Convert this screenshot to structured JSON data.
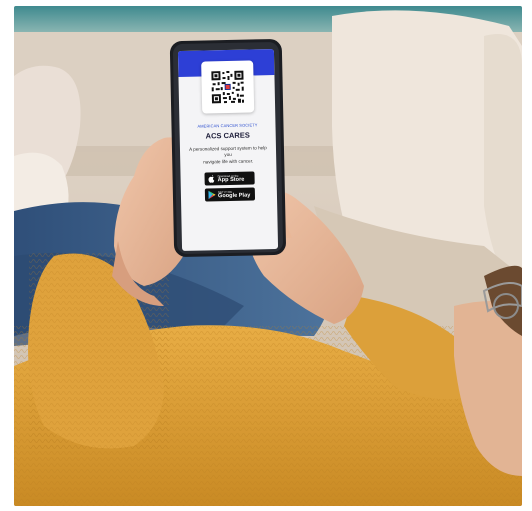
{
  "phone_screen": {
    "organization": "AMERICAN CANCER SOCIETY",
    "app_title": "ACS CARES",
    "tagline_line1": "A personalized support system to help you",
    "tagline_line2": "navigate life with cancer.",
    "app_store": {
      "small": "Download on the",
      "big": "App Store"
    },
    "google_play": {
      "small": "GET IT ON",
      "big": "Google Play"
    },
    "banner_color": "#2d3fd6"
  },
  "scene": {
    "sweater_color": "#e0a43c",
    "jeans_color": "#3b5e86",
    "couch_color": "#d8cbbc"
  }
}
